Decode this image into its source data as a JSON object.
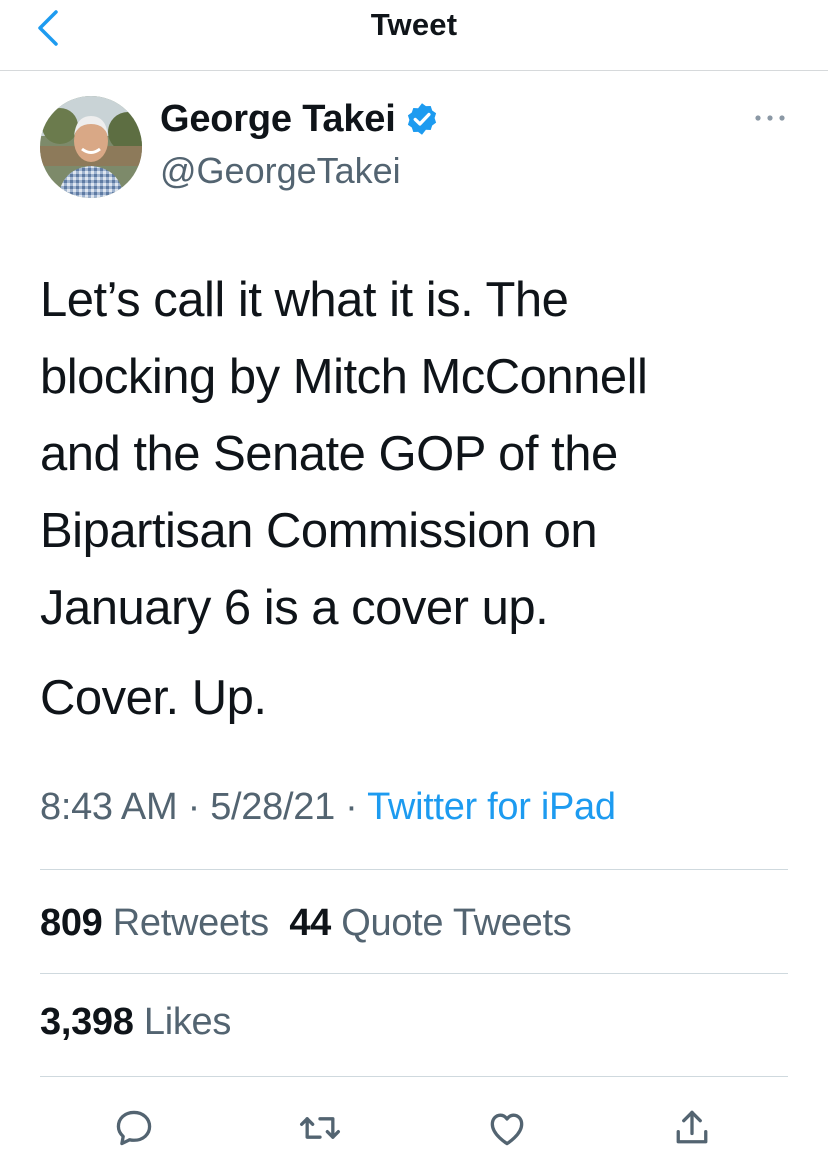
{
  "header": {
    "title": "Tweet",
    "back_icon": "chevron-left-icon"
  },
  "author": {
    "name": "George Takei",
    "handle": "@GeorgeTakei",
    "verified_icon": "verified-badge-icon"
  },
  "tweet": {
    "text_lines": [
      "Let’s call it what it is. The",
      "blocking by Mitch McConnell",
      "and the Senate GOP of the",
      "Bipartisan Commission on",
      "January 6 is a cover up."
    ],
    "text_second": "Cover. Up.",
    "time": "8:43 AM",
    "date": "5/28/21",
    "separator": "·",
    "source": "Twitter for iPad"
  },
  "stats": {
    "retweets_count": "809",
    "retweets_label": "Retweets",
    "quotes_count": "44",
    "quotes_label": "Quote Tweets",
    "likes_count": "3,398",
    "likes_label": "Likes"
  },
  "actions": [
    "reply-icon",
    "retweet-icon",
    "like-icon",
    "share-icon"
  ],
  "colors": {
    "accent": "#1d9bf0",
    "secondary_text": "#536471",
    "primary_text": "#0f1419",
    "divider": "#cfd9de"
  }
}
